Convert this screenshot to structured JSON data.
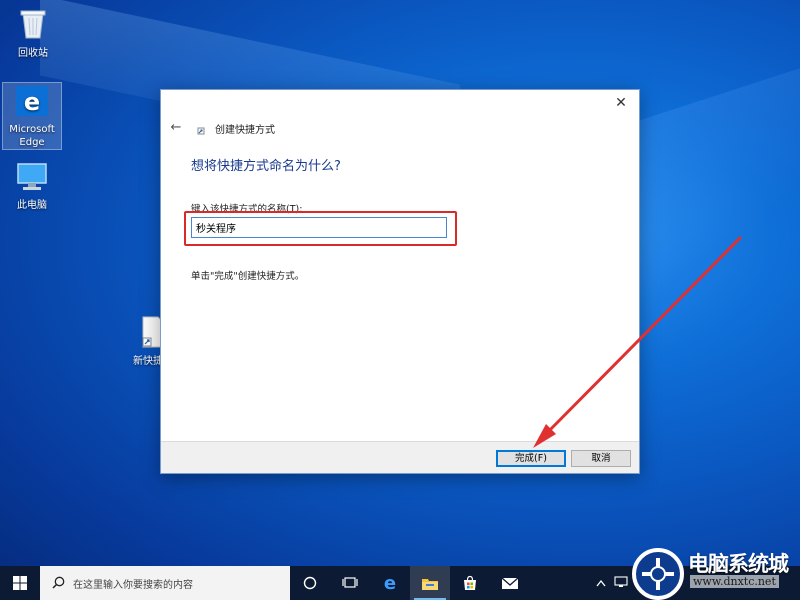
{
  "desktop": {
    "icons": {
      "recycle_bin": "回收站",
      "edge_line1": "Microsoft",
      "edge_line2": "Edge",
      "this_pc": "此电脑",
      "new_shortcut": "新快捷方"
    }
  },
  "dialog": {
    "title": "创建快捷方式",
    "heading": "想将快捷方式命名为什么?",
    "field_label": "键入该快捷方式的名称(T):",
    "name_value": "秒关程序",
    "hint": "单击\"完成\"创建快捷方式。",
    "finish_label": "完成(F)",
    "cancel_label": "取消",
    "close_glyph": "✕",
    "back_glyph": "←"
  },
  "taskbar": {
    "search_placeholder": "在这里输入你要搜索的内容",
    "icons": [
      "windows-logo-icon",
      "search-icon",
      "cortana-icon",
      "task-view-icon",
      "edge-icon",
      "file-explorer-icon",
      "store-icon",
      "mail-icon",
      "tray-chevron-icon",
      "network-icon"
    ]
  },
  "watermark": {
    "name": "电脑系统城",
    "url": "www.dnxtc.net"
  },
  "colors": {
    "accent": "#0078d7",
    "highlight": "#d92a2a",
    "heading": "#1a3a8c",
    "taskbar": "#0c1b33"
  }
}
